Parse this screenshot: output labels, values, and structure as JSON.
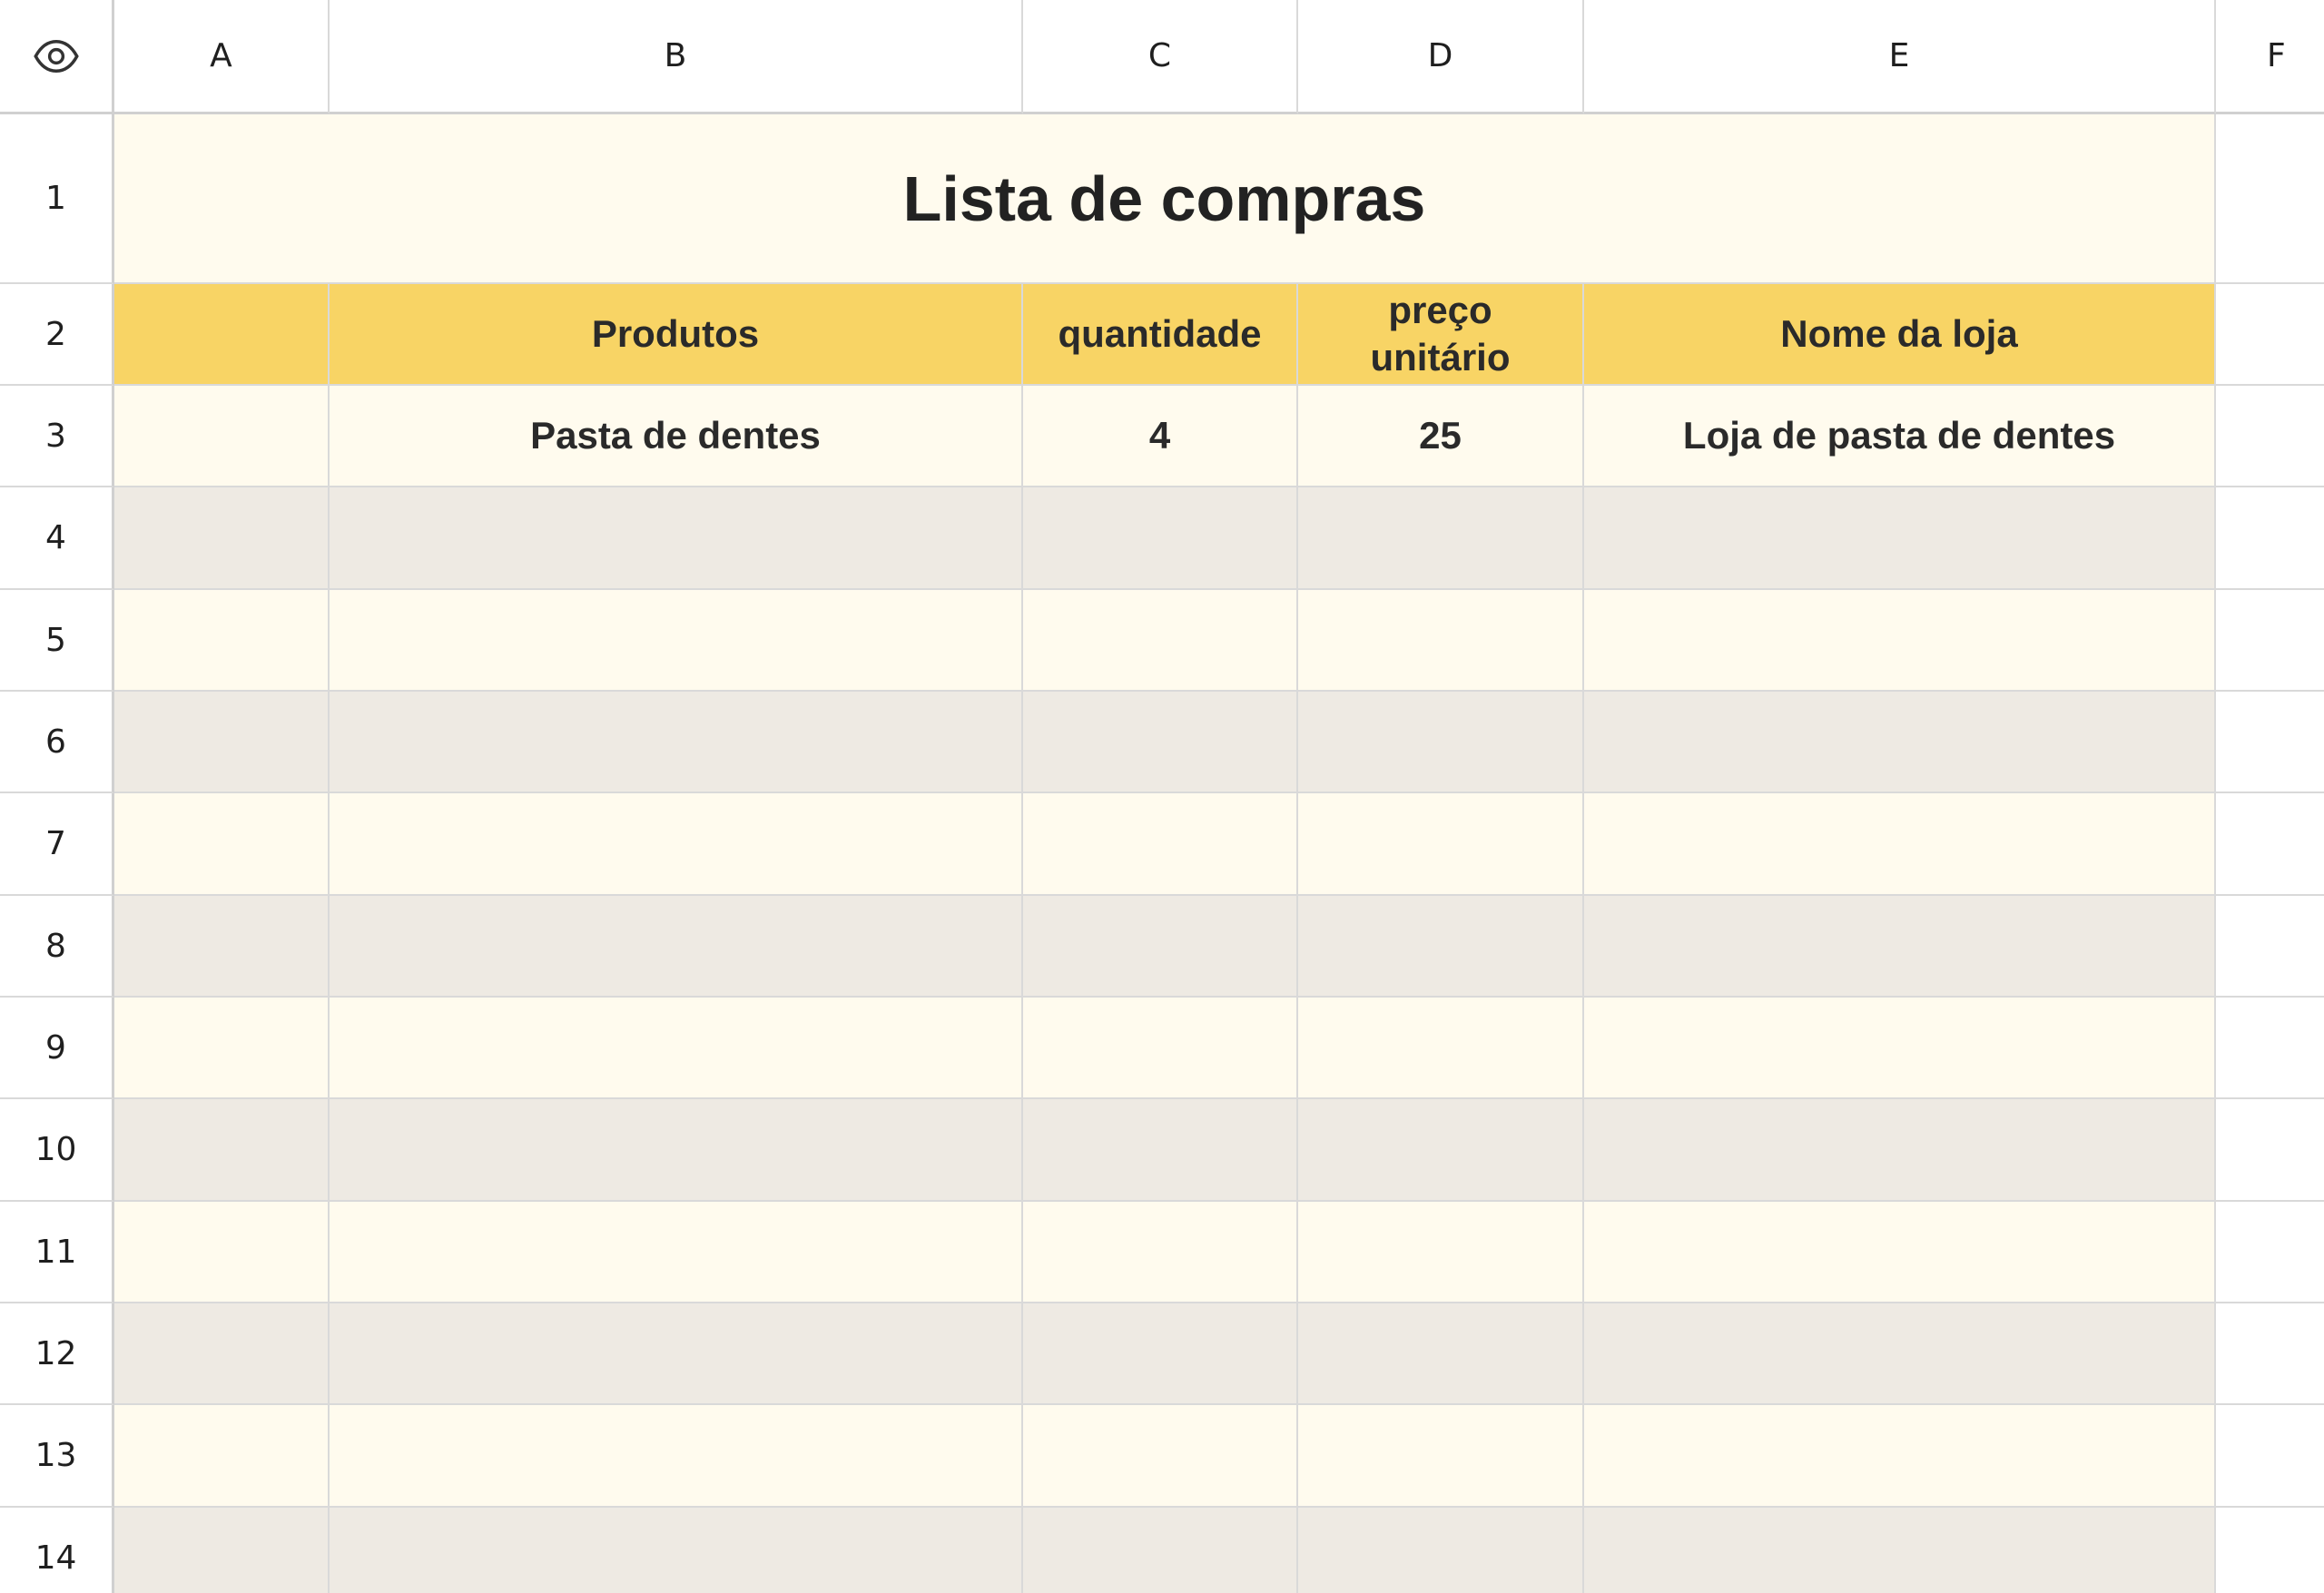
{
  "columns": [
    "A",
    "B",
    "C",
    "D",
    "E",
    "F"
  ],
  "rows": [
    "1",
    "2",
    "3",
    "4",
    "5",
    "6",
    "7",
    "8",
    "9",
    "10",
    "11",
    "12",
    "13",
    "14"
  ],
  "corner_icon": "eye-icon",
  "sheet": {
    "title": "Lista de compras",
    "headers": [
      "",
      "Produtos",
      "quantidade",
      "preço unitário",
      "Nome da loja"
    ],
    "items": [
      [
        "",
        "Pasta de dentes",
        "4",
        "25",
        "Loja de pasta de dentes"
      ]
    ]
  },
  "colors": {
    "header_fill": "#f8d465",
    "band_light": "#fffbee",
    "band_dark": "#eeeae3"
  }
}
